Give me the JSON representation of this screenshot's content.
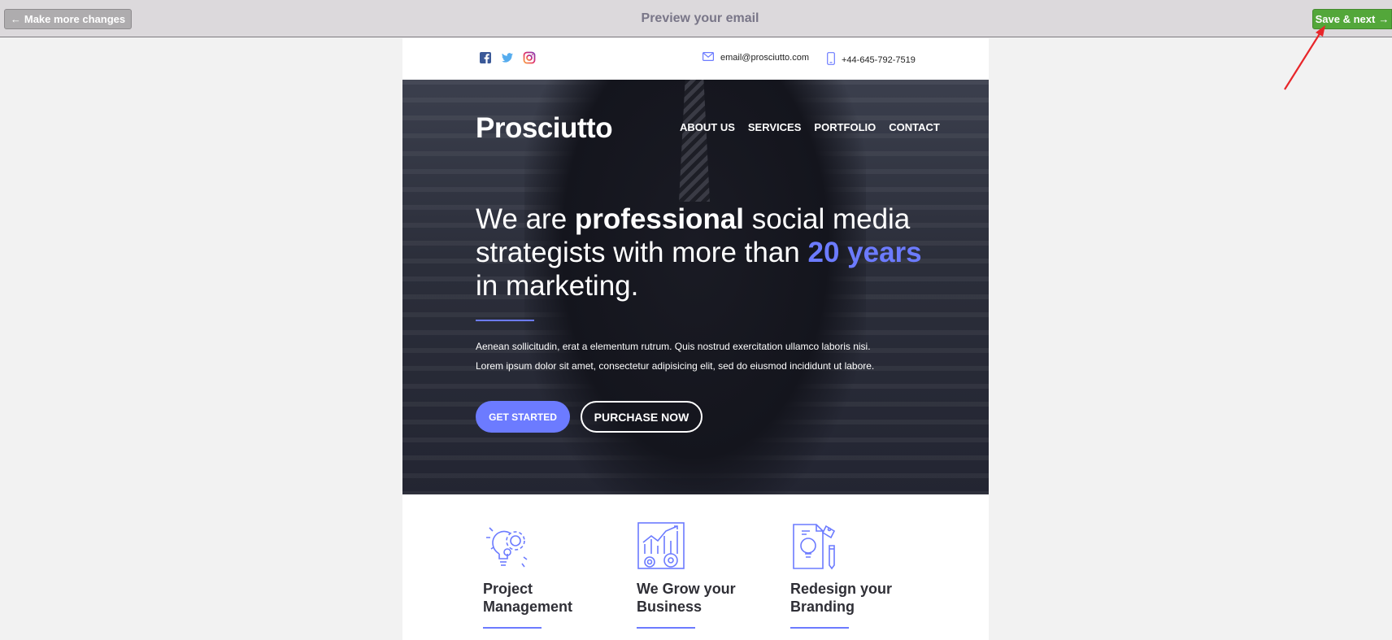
{
  "topbar": {
    "back_label": "Make more changes",
    "title": "Preview your email",
    "save_label": "Save & next"
  },
  "email": {
    "info_bar": {
      "social_icons": [
        "facebook-icon",
        "twitter-icon",
        "instagram-icon"
      ],
      "email": "email@prosciutto.com",
      "phone": "+44-645-792-7519"
    },
    "hero": {
      "brand": "Prosciutto",
      "nav": [
        "ABOUT US",
        "SERVICES",
        "PORTFOLIO",
        "CONTACT"
      ],
      "headline": {
        "part1": "We are ",
        "bold": "professional",
        "part2": " social media strategists with more than ",
        "accent": "20 years",
        "part3": " in marketing."
      },
      "body_line1": "Aenean sollicitudin, erat a elementum rutrum. Quis nostrud exercitation ullamco laboris nisi.",
      "body_line2": "Lorem ipsum dolor sit amet, consectetur adipisicing elit, sed do eiusmod incididunt ut labore.",
      "primary_button": "GET STARTED",
      "secondary_button": "PURCHASE NOW"
    },
    "features": [
      {
        "icon": "lightbulb-gears-icon",
        "title_line1": "Project",
        "title_line2": "Management"
      },
      {
        "icon": "chart-gears-icon",
        "title_line1": "We Grow your",
        "title_line2": "Business"
      },
      {
        "icon": "document-idea-icon",
        "title_line1": "Redesign your",
        "title_line2": "Branding"
      }
    ]
  },
  "colors": {
    "accent": "#6c7bff",
    "save_button": "#53a73a",
    "back_button": "#aeacae",
    "annotation_arrow": "#e8262a"
  }
}
